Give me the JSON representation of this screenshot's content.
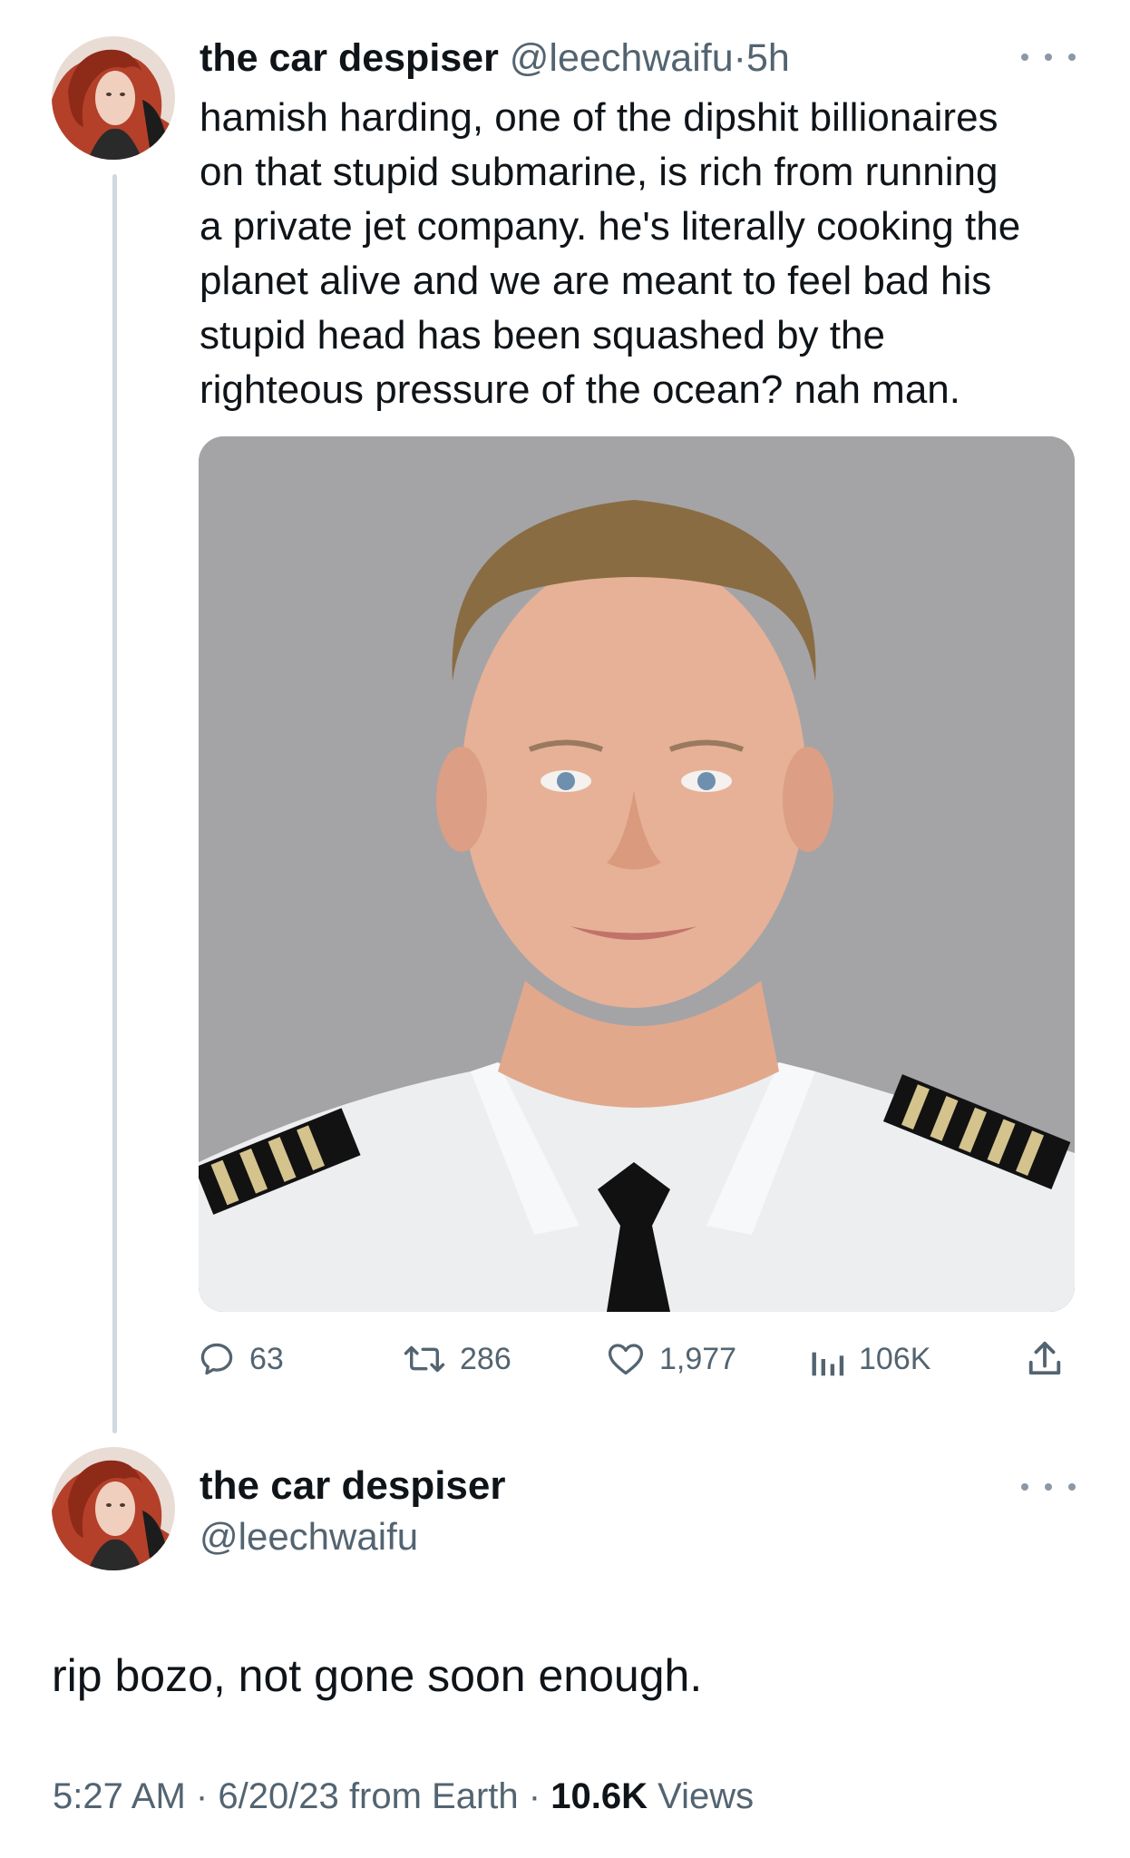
{
  "tweet1": {
    "author_name": "the car despiser",
    "handle": "@leechwaifu",
    "separator": "·",
    "time": "5h",
    "text": "hamish harding, one of the dipshit billionaires\non that stupid submarine, is rich from running\na private jet company. he's literally cooking the\nplanet alive and we are meant to feel bad his\nstupid head has been squashed by the\nrighteous pressure of the ocean? nah man.",
    "actions": {
      "replies": "63",
      "retweets": "286",
      "likes": "1,977",
      "views": "106K"
    }
  },
  "tweet2": {
    "author_name": "the car despiser",
    "handle": "@leechwaifu",
    "text": "rip bozo, not gone soon enough.",
    "time": "5:27 AM",
    "date": "6/20/23",
    "source": "from Earth",
    "separator": "·",
    "views_count": "10.6K",
    "views_label": "Views"
  },
  "icons": {
    "more": "more-horizontal-icon",
    "reply": "reply-bubble-icon",
    "retweet": "retweet-arrows-icon",
    "like": "heart-icon",
    "views": "bar-chart-icon",
    "share": "share-upload-icon"
  },
  "colors": {
    "text_primary": "#0f1419",
    "text_secondary": "#536471",
    "thread_line": "#cfd9de",
    "photo_background": "#a3a3a6"
  }
}
